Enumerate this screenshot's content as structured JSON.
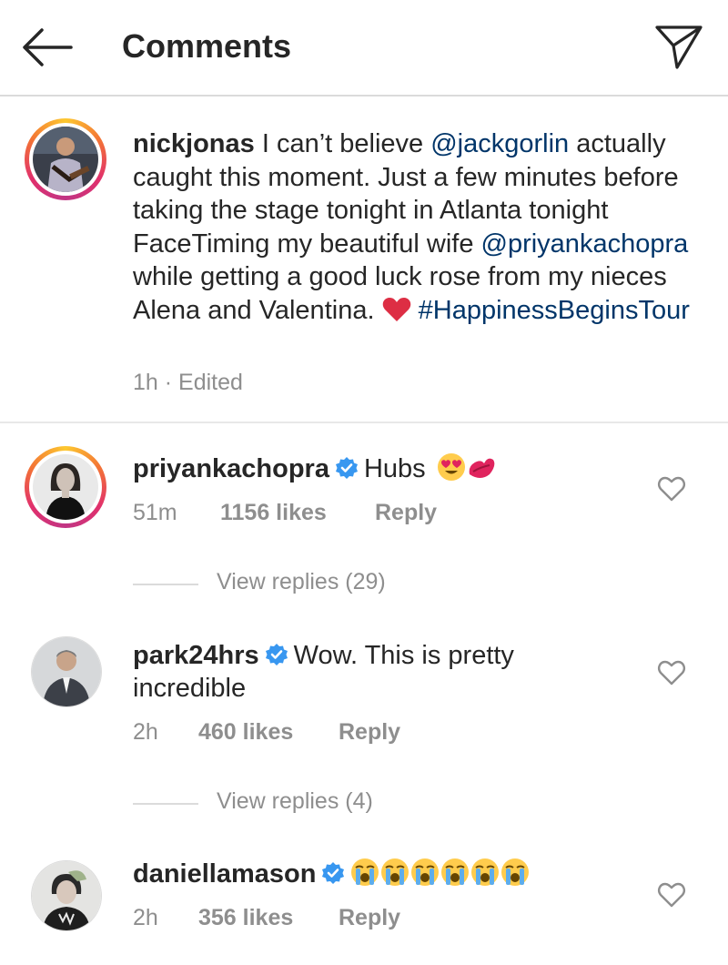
{
  "header": {
    "title": "Comments",
    "back_icon": "arrow-left-icon",
    "share_icon": "paper-plane-icon"
  },
  "caption": {
    "username": "nickjonas",
    "text_1": " I can’t believe ",
    "mention_1": "@jackgorlin",
    "text_2": " actually caught this moment. Just a few minutes before taking the stage tonight in Atlanta tonight FaceTiming my beautiful wife ",
    "mention_2": "@priyankachopra",
    "text_3": " while getting a good luck rose from my nieces Alena and Valentina. ",
    "emoji": "red-heart",
    "hashtag": "#HappinessBeginsTour",
    "time": "1h",
    "separator": "·",
    "edited": "Edited"
  },
  "comments": [
    {
      "username": "priyankachopra",
      "verified": true,
      "text": "Hubs",
      "emojis": [
        "heart-eyes",
        "kiss-mark"
      ],
      "time": "51m",
      "likes": "1156 likes",
      "reply": "Reply",
      "view_replies": "View replies (29)"
    },
    {
      "username": "park24hrs",
      "verified": true,
      "text": "Wow. This is pretty incredible",
      "time": "2h",
      "likes": "460 likes",
      "reply": "Reply",
      "view_replies": "View replies (4)"
    },
    {
      "username": "daniellamason",
      "verified": true,
      "emojis": [
        "loudly-crying",
        "loudly-crying",
        "loudly-crying",
        "loudly-crying",
        "loudly-crying",
        "loudly-crying"
      ],
      "time": "2h",
      "likes": "356 likes",
      "reply": "Reply"
    }
  ],
  "colors": {
    "link": "#003569",
    "muted": "#8e8e8e",
    "verified": "#3897f0",
    "heart": "#ed4956"
  }
}
